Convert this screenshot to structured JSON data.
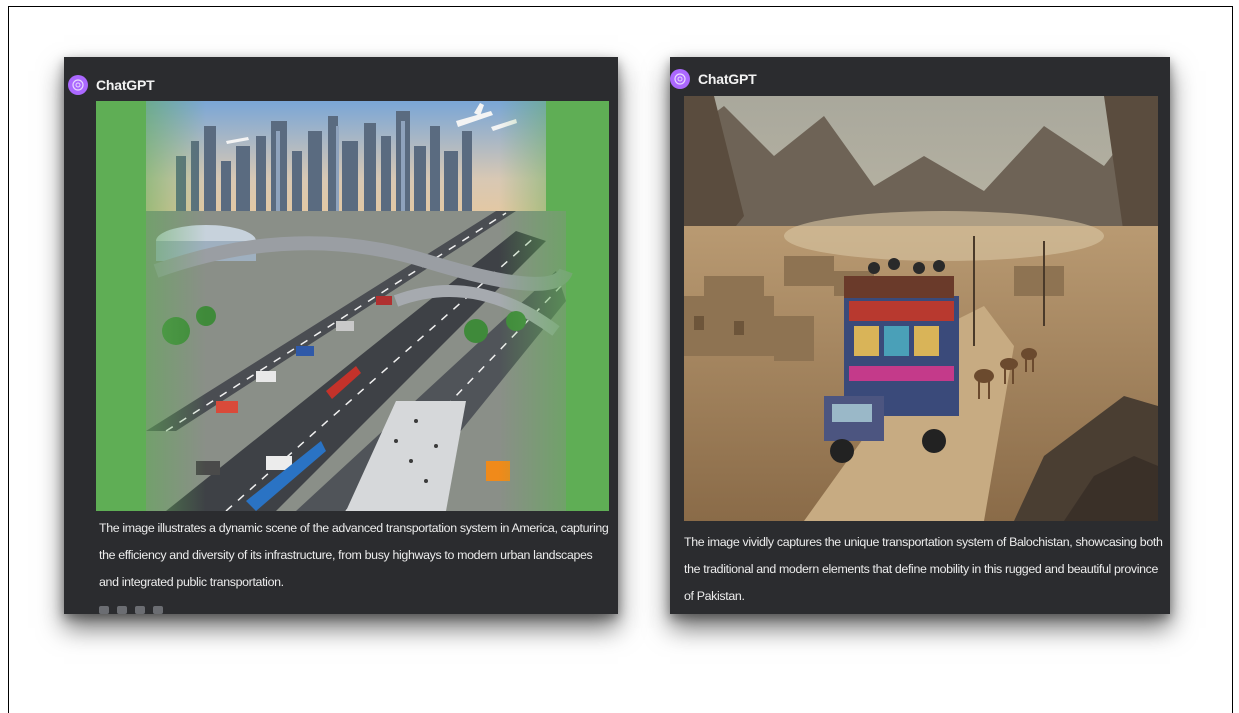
{
  "cards": [
    {
      "author": "ChatGPT",
      "image_subject": "advanced transportation system in America",
      "caption": "The image illustrates a dynamic scene of the advanced transportation system in America, capturing the efficiency and diversity of its infrastructure, from busy highways to modern urban landscapes and integrated public transportation."
    },
    {
      "author": "ChatGPT",
      "image_subject": "transportation system of Balochistan",
      "caption": "The image vividly captures the unique transportation system of Balochistan, showcasing both the traditional and modern elements that define mobility in this rugged and beautiful province of Pakistan."
    }
  ],
  "colors": {
    "card_bg": "#2b2c2f",
    "avatar": "#ab68ff",
    "green_border": "#5fae55"
  },
  "icons": [
    "chatgpt-logo-icon",
    "copy-icon",
    "thumbs-up-icon",
    "thumbs-down-icon",
    "regenerate-icon"
  ]
}
